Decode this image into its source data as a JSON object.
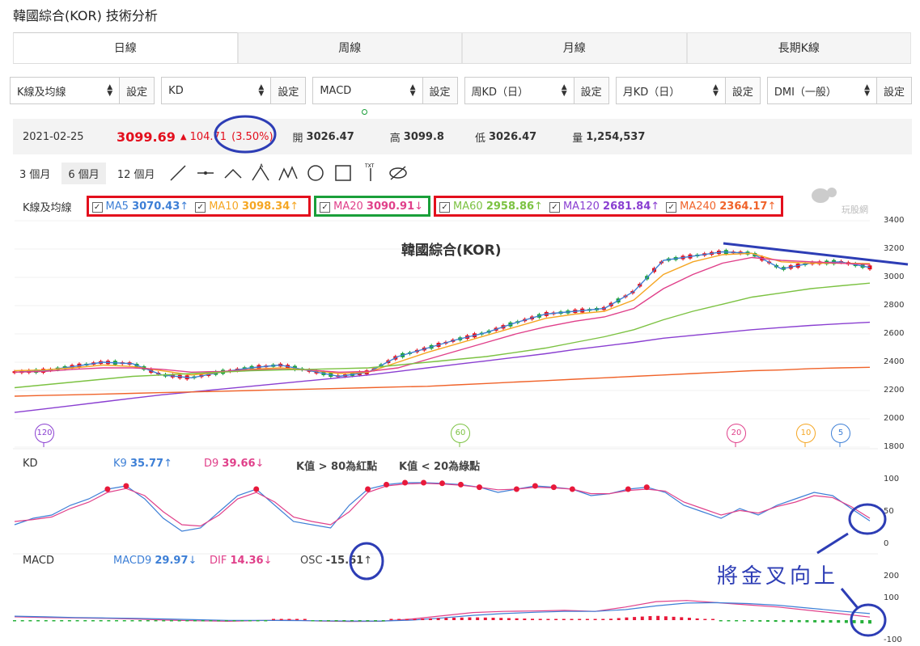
{
  "title": "韓國綜合(KOR) 技術分析",
  "tabs": [
    "日線",
    "周線",
    "月線",
    "長期K線"
  ],
  "selectors": [
    {
      "value": "K線及均線",
      "button": "設定"
    },
    {
      "value": "KD",
      "button": "設定"
    },
    {
      "value": "MACD",
      "button": "設定"
    },
    {
      "value": "周KD（日）",
      "button": "設定"
    },
    {
      "value": "月KD（日）",
      "button": "設定"
    },
    {
      "value": "DMI（一般）",
      "button": "設定"
    }
  ],
  "quote": {
    "date": "2021-02-25",
    "price": "3099.69",
    "change": "104.71",
    "change_pct": "(3.50%)",
    "open_label": "開",
    "open": "3026.47",
    "high_label": "高",
    "high": "3099.8",
    "low_label": "低",
    "low": "3026.47",
    "vol_label": "量",
    "vol": "1,254,537"
  },
  "ranges": [
    "3 個月",
    "6 個月",
    "12 個月"
  ],
  "ma_legend": {
    "label": "K線及均線",
    "items": [
      {
        "name": "MA5",
        "value": "3070.43",
        "arrow": "↑",
        "color": "#3d7fd6"
      },
      {
        "name": "MA10",
        "value": "3098.34",
        "arrow": "↑",
        "color": "#f5a623"
      },
      {
        "name": "MA20",
        "value": "3090.91",
        "arrow": "↓",
        "color": "#e0408a"
      },
      {
        "name": "MA60",
        "value": "2958.86",
        "arrow": "↑",
        "color": "#7cc242"
      },
      {
        "name": "MA120",
        "value": "2681.84",
        "arrow": "↑",
        "color": "#8a3fd1"
      },
      {
        "name": "MA240",
        "value": "2364.17",
        "arrow": "↑",
        "color": "#f0632a"
      }
    ]
  },
  "watermark": "玩股網",
  "chart_title": "韓國綜合(KOR)",
  "price_axis": [
    "3400",
    "3200",
    "3000",
    "2800",
    "2600",
    "2400",
    "2200",
    "2000",
    "1800"
  ],
  "ma_markers": [
    "120",
    "60",
    "20",
    "10",
    "5"
  ],
  "kd": {
    "label": "KD",
    "k_name": "K9",
    "k_value": "35.77",
    "k_arrow": "↑",
    "d_name": "D9",
    "d_value": "39.66",
    "d_arrow": "↓",
    "note1": "K值 > 80為紅點",
    "note2": "K值 < 20為綠點",
    "axis": [
      "100",
      "50",
      "0"
    ]
  },
  "macd": {
    "label": "MACD",
    "macd_name": "MACD9",
    "macd_value": "29.97",
    "macd_arrow": "↓",
    "dif_name": "DIF",
    "dif_value": "14.36",
    "dif_arrow": "↓",
    "osc_name": "OSC",
    "osc_value": "-15.61",
    "osc_arrow": "↑",
    "axis": [
      "200",
      "100",
      "-100"
    ]
  },
  "annotation": "將金叉向上",
  "chart_data": {
    "type": "line",
    "title": "韓國綜合(KOR)",
    "ylim": [
      1800,
      3400
    ],
    "series": [
      {
        "name": "MA5",
        "values": [
          2330,
          2340,
          2370,
          2400,
          2390,
          2310,
          2290,
          2330,
          2360,
          2380,
          2340,
          2300,
          2330,
          2440,
          2500,
          2560,
          2610,
          2680,
          2740,
          2760,
          2780,
          2900,
          3120,
          3150,
          3180,
          3170,
          3060,
          3100,
          3110,
          3070
        ]
      },
      {
        "name": "MA10",
        "values": [
          2340,
          2345,
          2360,
          2380,
          2370,
          2340,
          2310,
          2330,
          2350,
          2360,
          2345,
          2320,
          2330,
          2400,
          2470,
          2530,
          2590,
          2650,
          2710,
          2740,
          2760,
          2840,
          3020,
          3110,
          3160,
          3170,
          3110,
          3100,
          3100,
          3098
        ]
      },
      {
        "name": "MA20",
        "values": [
          2330,
          2335,
          2350,
          2360,
          2360,
          2350,
          2330,
          2335,
          2345,
          2350,
          2345,
          2330,
          2335,
          2360,
          2420,
          2480,
          2540,
          2600,
          2650,
          2690,
          2720,
          2780,
          2920,
          3020,
          3100,
          3140,
          3120,
          3110,
          3100,
          3091
        ]
      },
      {
        "name": "MA60",
        "values": [
          2220,
          2240,
          2260,
          2280,
          2300,
          2310,
          2320,
          2330,
          2340,
          2345,
          2350,
          2355,
          2360,
          2380,
          2400,
          2420,
          2440,
          2470,
          2500,
          2540,
          2580,
          2630,
          2700,
          2760,
          2810,
          2860,
          2890,
          2920,
          2940,
          2959
        ]
      },
      {
        "name": "MA120",
        "values": [
          2045,
          2070,
          2095,
          2120,
          2145,
          2170,
          2190,
          2210,
          2230,
          2250,
          2270,
          2290,
          2310,
          2335,
          2360,
          2385,
          2410,
          2435,
          2460,
          2490,
          2515,
          2540,
          2570,
          2590,
          2610,
          2630,
          2645,
          2660,
          2672,
          2682
        ]
      },
      {
        "name": "MA240",
        "values": [
          2160,
          2165,
          2170,
          2175,
          2180,
          2185,
          2190,
          2195,
          2200,
          2205,
          2210,
          2215,
          2220,
          2225,
          2230,
          2240,
          2250,
          2260,
          2270,
          2280,
          2290,
          2300,
          2310,
          2320,
          2330,
          2340,
          2345,
          2355,
          2360,
          2364
        ]
      }
    ]
  }
}
